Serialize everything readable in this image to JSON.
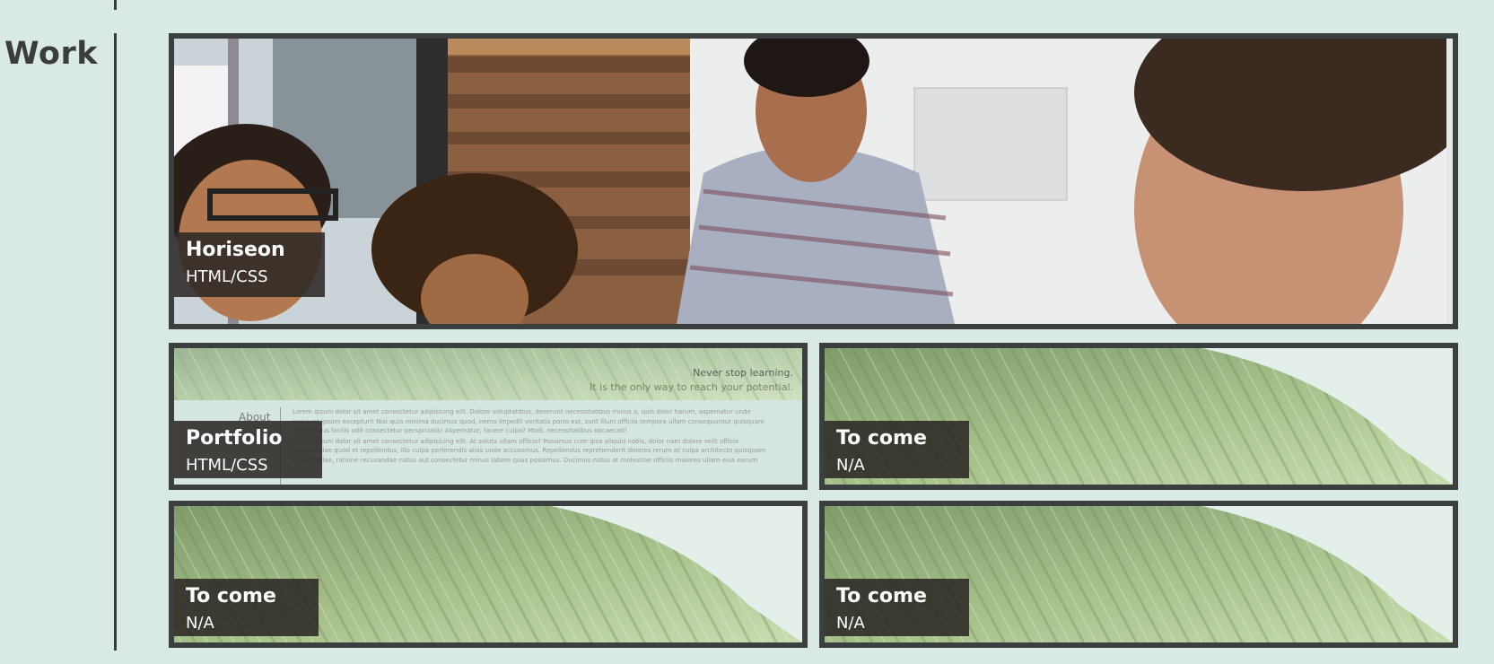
{
  "section": {
    "title": "Work"
  },
  "projects": [
    {
      "name": "Horiseon",
      "tech": "HTML/CSS",
      "image": "team-meeting-photo"
    },
    {
      "name": "Portfolio",
      "tech": "HTML/CSS",
      "image": "portfolio-site-screenshot"
    },
    {
      "name": "To come",
      "tech": "N/A",
      "image": "leaf-photo"
    },
    {
      "name": "To come",
      "tech": "N/A",
      "image": "leaf-photo"
    },
    {
      "name": "To come",
      "tech": "N/A",
      "image": "leaf-photo"
    }
  ],
  "portfolio_preview": {
    "banner_line1": "Never stop learning.",
    "banner_line2": "It is the only way to reach your potential.",
    "nav_about": "About",
    "paragraph1": "Lorem ipsum dolor sit amet consectetur adipisicing elit. Dolore voluptatibus, deserunt necessitatibus minus a, quis dolor harum, aspernatur unde nesciunt ipsam excepturi! Nisi quia minima ducimus quod, nemo impedit veritatis porro est, sunt illum officiis tempora ullam consequuntur quisquam repellendus facilis odit consectetur perspiciatis! Aspernatur, facere culpa? Modi, necessitatibus obcaecati!",
    "paragraph2": "Lorem ipsum dolor sit amet consectetur adipisicing elit. At soluta ullam officia? Possimus cum ipsa aliquid nobis, dolor nam dolore velit officia repudiandae quod et repellendus, illo culpa perferendis alias unde accusamus. Repellendus reprehenderit dolores rerum at culpa architecto quisquam repudiandae, ratione recusandae natus aut consectetur minus labore quas possimus. Ducimus natus at molestiae officiis maiores ullam eius earum laborum."
  },
  "colors": {
    "background": "#d9e9e3",
    "frame": "#3c3f40",
    "label_bg": "#2c2826",
    "label_text": "#ffffff"
  }
}
